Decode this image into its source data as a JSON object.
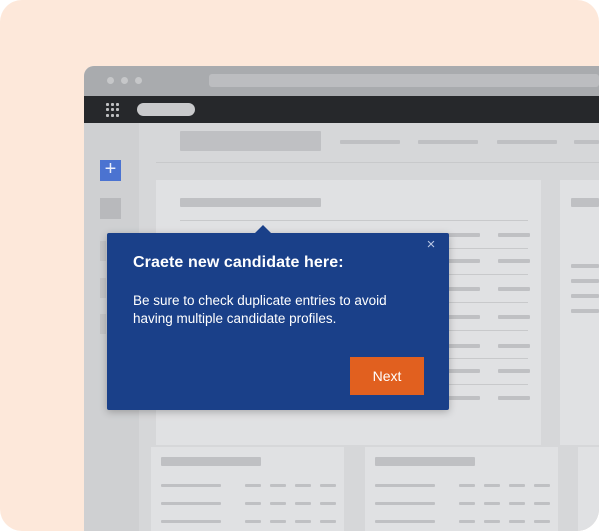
{
  "popover": {
    "title": "Craete new candidate here:",
    "body": "Be sure to check duplicate entries to avoid having multiple candidate profiles.",
    "next_label": "Next",
    "close_icon": "×"
  },
  "sidebar": {
    "add_icon": "+"
  },
  "colors": {
    "background_card": "#fde8da",
    "popover": "#1a4089",
    "next_button": "#e1601f",
    "add_button": "#4b73d1",
    "app_bar": "#26282b"
  }
}
